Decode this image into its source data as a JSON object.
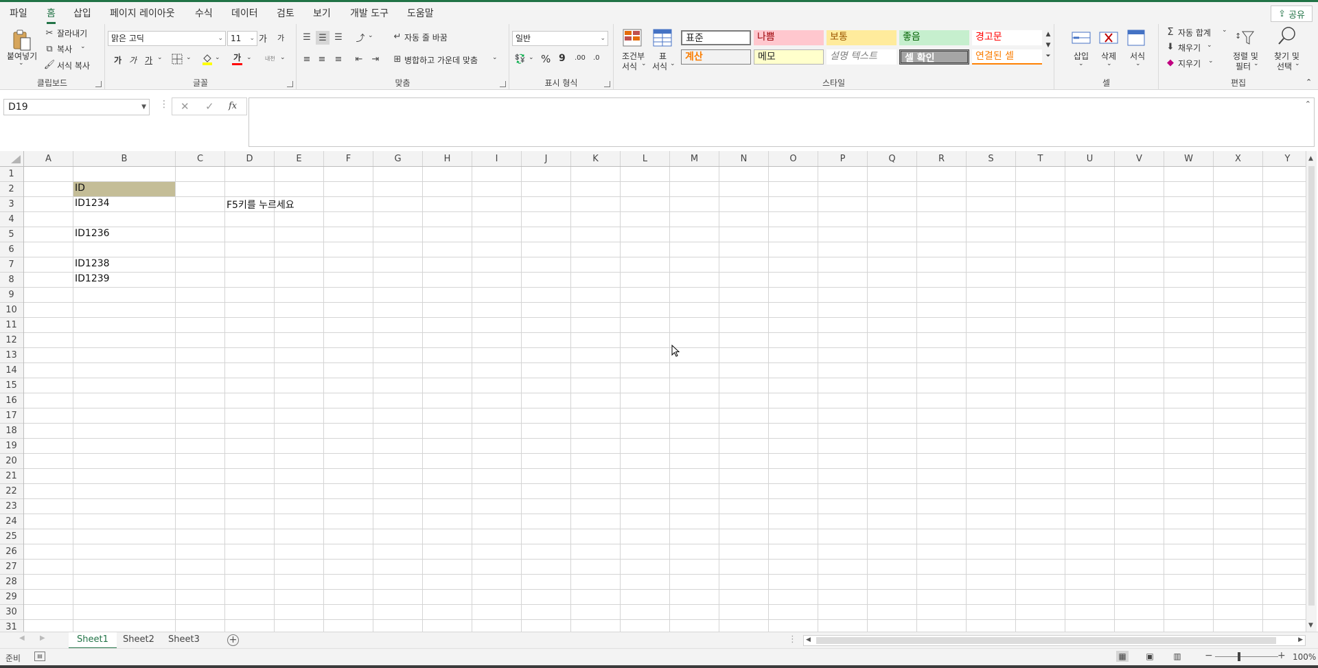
{
  "menu": {
    "tabs": [
      "파일",
      "홈",
      "삽입",
      "페이지 레이아웃",
      "수식",
      "데이터",
      "검토",
      "보기",
      "개발 도구",
      "도움말"
    ],
    "active": "홈",
    "share": "공유"
  },
  "ribbon": {
    "clipboard": {
      "label": "클립보드",
      "paste": "붙여넣기",
      "cut": "잘라내기",
      "copy": "복사",
      "format_painter": "서식 복사"
    },
    "font": {
      "label": "글꼴",
      "font_name": "맑은 고딕",
      "font_size": "11",
      "bold": "가",
      "italic": "가",
      "underline": "가",
      "increase": "가",
      "decrease": "가",
      "color_glyph": "가",
      "phonetic": "내천"
    },
    "alignment": {
      "label": "맞춤",
      "wrap_text": "자동 줄 바꿈",
      "merge_center": "병합하고 가운데 맞춤"
    },
    "number": {
      "label": "표시 형식",
      "format": "일반",
      "percent": "%",
      "comma": "9",
      "inc_dec": ".00",
      "dec_dec": ".0"
    },
    "styles": {
      "label": "스타일",
      "conditional": "조건부 서식",
      "conditional_lines": [
        "조건부",
        "서식"
      ],
      "table": "표 서식",
      "table_lines": [
        "표",
        "서식"
      ],
      "cells": [
        "표준",
        "나쁨",
        "보통",
        "좋음",
        "경고문",
        "계산",
        "메모",
        "설명 텍스트",
        "셀 확인",
        "연결된 셀"
      ]
    },
    "cells": {
      "label": "셀",
      "insert": "삽입",
      "delete": "삭제",
      "format": "서식"
    },
    "editing": {
      "label": "편집",
      "autosum": "자동 합계",
      "fill": "채우기",
      "clear": "지우기",
      "sort": [
        "정렬 및",
        "필터"
      ],
      "find": [
        "찾기 및",
        "선택"
      ]
    }
  },
  "formula_bar": {
    "name_box": "D19",
    "cancel": "✕",
    "enter": "✓",
    "fx": "fx",
    "formula": ""
  },
  "grid": {
    "columns": [
      "A",
      "B",
      "C",
      "D",
      "E",
      "F",
      "G",
      "H",
      "I",
      "J",
      "K",
      "L",
      "M",
      "N",
      "O",
      "P",
      "Q",
      "R",
      "S",
      "T",
      "U",
      "V",
      "W",
      "X",
      "Y"
    ],
    "rows": [
      "1",
      "2",
      "3",
      "4",
      "5",
      "6",
      "7",
      "8",
      "9",
      "10",
      "11",
      "12",
      "13",
      "14",
      "15",
      "16",
      "17",
      "18",
      "19",
      "20",
      "21",
      "22",
      "23",
      "24",
      "25",
      "26",
      "27",
      "28",
      "29",
      "30",
      "31"
    ],
    "cells": [
      {
        "ref": "B2",
        "col": 1,
        "row": 1,
        "text": "ID",
        "highlight": "#c4bd97"
      },
      {
        "ref": "B3",
        "col": 1,
        "row": 2,
        "text": "ID1234"
      },
      {
        "ref": "D3",
        "col": 3,
        "row": 2,
        "text": "F5키를 누르세요"
      },
      {
        "ref": "B5",
        "col": 1,
        "row": 4,
        "text": "ID1236"
      },
      {
        "ref": "B7",
        "col": 1,
        "row": 6,
        "text": "ID1238"
      },
      {
        "ref": "B8",
        "col": 1,
        "row": 7,
        "text": "ID1239"
      }
    ]
  },
  "sheets": {
    "tabs": [
      "Sheet1",
      "Sheet2",
      "Sheet3"
    ],
    "active": "Sheet1"
  },
  "status": {
    "ready": "준비",
    "zoom": "100%"
  },
  "colors": {
    "accent": "#217346",
    "bad_bg": "#ffc7ce",
    "bad_fg": "#9c0006",
    "neutral_bg": "#ffeb9c",
    "good_bg": "#c6efce",
    "good_fg": "#006100",
    "warn_fg": "#ff0000",
    "calc_fg": "#fa7d00",
    "check_bg": "#a5a5a5",
    "linked_fg": "#fa7d00"
  }
}
